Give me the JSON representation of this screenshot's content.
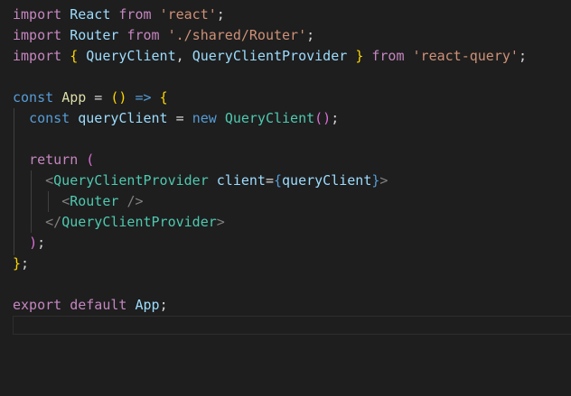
{
  "editor": {
    "colors": {
      "background": "#1e1e1e",
      "keyword_control": "#c586c0",
      "keyword": "#569cd6",
      "variable": "#9cdcfe",
      "string": "#ce9178",
      "function": "#dcdcaa",
      "class": "#4ec9b0",
      "punctuation": "#d4d4d4",
      "tag_bracket": "#808080",
      "bracket_1": "#ffd700",
      "bracket_2": "#da70d6",
      "bracket_3": "#179fff"
    },
    "lines": [
      [
        [
          "import",
          "pink"
        ],
        [
          " ",
          "text"
        ],
        [
          "React",
          "var"
        ],
        [
          " ",
          "text"
        ],
        [
          "from",
          "pink"
        ],
        [
          " ",
          "text"
        ],
        [
          "'react'",
          "str"
        ],
        [
          ";",
          "text"
        ]
      ],
      [
        [
          "import",
          "pink"
        ],
        [
          " ",
          "text"
        ],
        [
          "Router",
          "var"
        ],
        [
          " ",
          "text"
        ],
        [
          "from",
          "pink"
        ],
        [
          " ",
          "text"
        ],
        [
          "'./shared/Router'",
          "str"
        ],
        [
          ";",
          "text"
        ]
      ],
      [
        [
          "import",
          "pink"
        ],
        [
          " ",
          "text"
        ],
        [
          "{",
          "yellow"
        ],
        [
          " ",
          "text"
        ],
        [
          "QueryClient",
          "var"
        ],
        [
          ", ",
          "text"
        ],
        [
          "QueryClientProvider",
          "var"
        ],
        [
          " ",
          "text"
        ],
        [
          "}",
          "yellow"
        ],
        [
          " ",
          "text"
        ],
        [
          "from",
          "pink"
        ],
        [
          " ",
          "text"
        ],
        [
          "'react-query'",
          "str"
        ],
        [
          ";",
          "text"
        ]
      ],
      [],
      [
        [
          "const",
          "blue"
        ],
        [
          " ",
          "text"
        ],
        [
          "App",
          "fn"
        ],
        [
          " = ",
          "text"
        ],
        [
          "()",
          "yellow"
        ],
        [
          " ",
          "text"
        ],
        [
          "=>",
          "blue"
        ],
        [
          " ",
          "text"
        ],
        [
          "{",
          "yellow"
        ]
      ],
      [
        [
          "  ",
          "text"
        ],
        [
          "const",
          "blue"
        ],
        [
          " ",
          "text"
        ],
        [
          "queryClient",
          "var"
        ],
        [
          " = ",
          "text"
        ],
        [
          "new",
          "blue"
        ],
        [
          " ",
          "text"
        ],
        [
          "QueryClient",
          "cls"
        ],
        [
          "()",
          "purple"
        ],
        [
          ";",
          "text"
        ]
      ],
      [],
      [
        [
          "  ",
          "text"
        ],
        [
          "return",
          "pink"
        ],
        [
          " ",
          "text"
        ],
        [
          "(",
          "purple"
        ]
      ],
      [
        [
          "    ",
          "text"
        ],
        [
          "<",
          "tag"
        ],
        [
          "QueryClientProvider",
          "cls"
        ],
        [
          " ",
          "text"
        ],
        [
          "client",
          "var"
        ],
        [
          "=",
          "text"
        ],
        [
          "{",
          "blue"
        ],
        [
          "queryClient",
          "var"
        ],
        [
          "}",
          "blue"
        ],
        [
          ">",
          "tag"
        ]
      ],
      [
        [
          "      ",
          "text"
        ],
        [
          "<",
          "tag"
        ],
        [
          "Router",
          "cls"
        ],
        [
          " ",
          "text"
        ],
        [
          "/>",
          "tag"
        ]
      ],
      [
        [
          "    ",
          "text"
        ],
        [
          "</",
          "tag"
        ],
        [
          "QueryClientProvider",
          "cls"
        ],
        [
          ">",
          "tag"
        ]
      ],
      [
        [
          "  ",
          "text"
        ],
        [
          ")",
          "purple"
        ],
        [
          ";",
          "text"
        ]
      ],
      [
        [
          "}",
          "yellow"
        ],
        [
          ";",
          "text"
        ]
      ],
      [],
      [
        [
          "export",
          "pink"
        ],
        [
          " ",
          "text"
        ],
        [
          "default",
          "pink"
        ],
        [
          " ",
          "text"
        ],
        [
          "App",
          "var"
        ],
        [
          ";",
          "text"
        ]
      ],
      []
    ]
  }
}
